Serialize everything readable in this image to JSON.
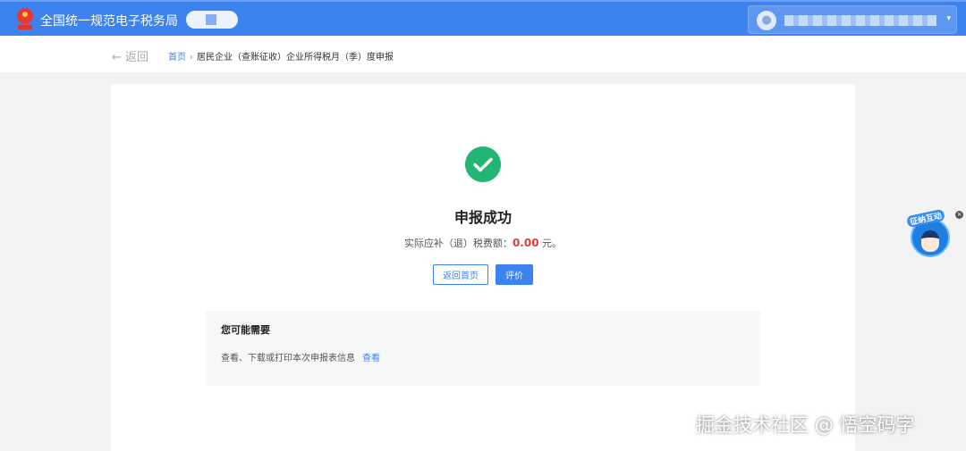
{
  "header": {
    "title": "全国统一规范电子税务局",
    "emblem": "national-tax-emblem"
  },
  "nav": {
    "back_label": "返回",
    "breadcrumb": [
      "首页",
      "居民企业（查账征收）企业所得税月（季）度申报"
    ]
  },
  "result": {
    "title": "申报成功",
    "amount_prefix": "实际应补（退）税费额：",
    "amount": "0.00",
    "amount_suffix": " 元。",
    "amount_color": "#e83a3a",
    "home_button": "返回首页",
    "rate_button": "评价"
  },
  "suggest": {
    "title": "您可能需要",
    "text": "查看、下载或打印本次申报表信息",
    "link": "查看"
  },
  "helper": {
    "label": "征纳互动"
  },
  "watermark": "掘金技术社区 @ 悟空码字"
}
